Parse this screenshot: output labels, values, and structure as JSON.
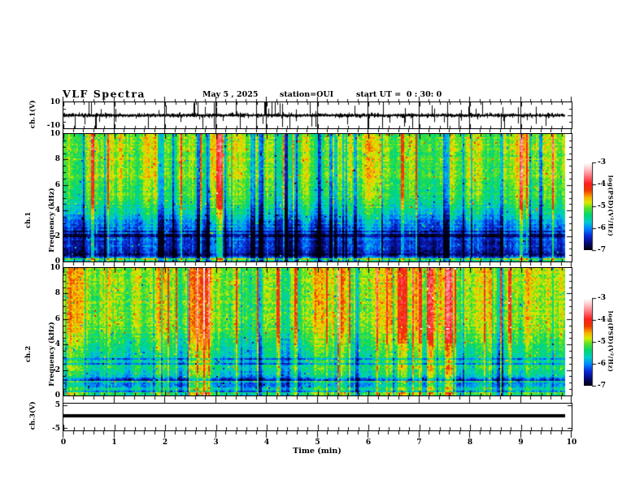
{
  "header": {
    "title": "VLF Spectra",
    "date": "May 5 , 2025",
    "station": "station=OUI",
    "start_ut": "start UT =  0 : 30: 0"
  },
  "x_axis": {
    "label": "Time (min)",
    "tick_labels": [
      "0",
      "1",
      "2",
      "3",
      "4",
      "5",
      "6",
      "7",
      "8",
      "9",
      "10"
    ],
    "range": [
      0,
      10
    ],
    "minor_ticks_per_major": 5
  },
  "panels": {
    "ch1_wave": {
      "y_label": "ch.1(V)",
      "tick_labels": [
        "10",
        "-10"
      ],
      "y_range": [
        -10,
        10
      ]
    },
    "ch1_spec": {
      "y_label_lines": [
        "ch.1",
        "Frequency (kHz)"
      ],
      "tick_labels": [
        "10",
        "8",
        "6",
        "4",
        "2",
        "0"
      ],
      "y_range": [
        0,
        10
      ]
    },
    "ch2_spec": {
      "y_label_lines": [
        "ch.2",
        "Frequency (kHz)"
      ],
      "tick_labels": [
        "10",
        "8",
        "6",
        "4",
        "2",
        "0"
      ],
      "y_range": [
        0,
        10
      ]
    },
    "ch3_wave": {
      "y_label": "ch.3(V)",
      "tick_labels": [
        "5",
        "-5"
      ],
      "y_range": [
        -5,
        5
      ]
    }
  },
  "colorbar": {
    "label": "log(PSD)(V²/Hz)",
    "tick_labels": [
      "-3",
      "-4",
      "-5",
      "-6",
      "-7"
    ],
    "range": [
      -7,
      -3
    ],
    "count": 2
  },
  "chart_data": [
    {
      "panel": "ch.1(V)",
      "type": "line",
      "xlabel": "Time (min)",
      "x_range": [
        0,
        10
      ],
      "y_range": [
        -10,
        10
      ],
      "y_ticks": [
        10,
        -10
      ],
      "description": "Broadband noise waveform centred on 0 V with many impulsive spikes reaching the ±10 V limits; vertical gridlines at every minute."
    },
    {
      "panel": "ch.1 spectrogram",
      "type": "heatmap",
      "xlabel": "Time (min)",
      "ylabel": "Frequency (kHz)",
      "x_range": [
        0,
        10
      ],
      "y_range": [
        0,
        10
      ],
      "z_label": "log(PSD)(V²/Hz)",
      "z_range": [
        -7,
        -3
      ],
      "background_levels": [
        {
          "freq_khz": [
            5,
            10
          ],
          "log_psd": -4.8
        },
        {
          "freq_khz": [
            3,
            5
          ],
          "log_psd": -5.5
        },
        {
          "freq_khz": [
            0.5,
            3
          ],
          "log_psd": -6.4
        },
        {
          "freq_khz": [
            0,
            0.3
          ],
          "log_psd": -4.9
        }
      ],
      "features": [
        "vertical red/orange impulse streaks above ~4 kHz",
        "dense dark-blue region with horizontal banding below ~3 kHz",
        "narrow green band along the bottom edge",
        "blue vertical dropout lines across all frequencies"
      ]
    },
    {
      "panel": "ch.2 spectrogram",
      "type": "heatmap",
      "xlabel": "Time (min)",
      "ylabel": "Frequency (kHz)",
      "x_range": [
        0,
        10
      ],
      "y_range": [
        0,
        10
      ],
      "z_label": "log(PSD)(V²/Hz)",
      "z_range": [
        -7,
        -3
      ],
      "background_levels": [
        {
          "freq_khz": [
            4,
            10
          ],
          "log_psd": -4.6
        },
        {
          "freq_khz": [
            2,
            4
          ],
          "log_psd": -5.3
        },
        {
          "freq_khz": [
            0,
            2
          ],
          "log_psd": -5.9
        }
      ],
      "features": [
        "stronger and denser red impulse streaks than ch.1",
        "bright cyan horizontal band near 2 kHz",
        "blue speckled horizontal bands below 2 kHz"
      ]
    },
    {
      "panel": "ch.3(V)",
      "type": "line",
      "xlabel": "Time (min)",
      "x_range": [
        0,
        10
      ],
      "y_range": [
        -5,
        5
      ],
      "y_ticks": [
        5,
        -5
      ],
      "description": "Flat thick black trace at 0 V for the whole 10 minutes."
    }
  ],
  "render": {
    "seeds": {
      "spec1": 12345,
      "spec2": 77777,
      "wave1": 424242
    },
    "colormap_stops": [
      [
        0.0,
        [
          255,
          255,
          255
        ]
      ],
      [
        0.07,
        [
          255,
          200,
          205
        ]
      ],
      [
        0.15,
        [
          255,
          120,
          130
        ]
      ],
      [
        0.24,
        [
          250,
          30,
          30
        ]
      ],
      [
        0.32,
        [
          235,
          60,
          0
        ]
      ],
      [
        0.4,
        [
          250,
          180,
          0
        ]
      ],
      [
        0.46,
        [
          215,
          235,
          0
        ]
      ],
      [
        0.52,
        [
          90,
          225,
          40
        ]
      ],
      [
        0.6,
        [
          0,
          215,
          110
        ]
      ],
      [
        0.68,
        [
          0,
          205,
          205
        ]
      ],
      [
        0.76,
        [
          0,
          130,
          255
        ]
      ],
      [
        0.84,
        [
          10,
          40,
          215
        ]
      ],
      [
        0.92,
        [
          5,
          10,
          120
        ]
      ],
      [
        1.0,
        [
          0,
          0,
          15
        ]
      ]
    ],
    "spec1": {
      "profile": [
        [
          0,
          0.49
        ],
        [
          0.3,
          0.5
        ],
        [
          0.5,
          0.56
        ],
        [
          0.62,
          0.64
        ],
        [
          0.72,
          0.76
        ],
        [
          0.82,
          0.82
        ],
        [
          0.94,
          0.85
        ],
        [
          0.972,
          0.87
        ],
        [
          0.982,
          0.5
        ],
        [
          1,
          0.55
        ]
      ],
      "red_prob": 0.055,
      "red_amt": 0.26,
      "blue_prob": 0.1,
      "blue_amt": 0.2,
      "noise": 0.1,
      "band_start": 0.66,
      "dark_row_prob": 0.22,
      "dark_row_amt": 0.1,
      "bright_row_prob": 0.07,
      "bright_row_amt": -0.13
    },
    "spec2": {
      "profile": [
        [
          0,
          0.47
        ],
        [
          0.45,
          0.49
        ],
        [
          0.6,
          0.58
        ],
        [
          0.72,
          0.64
        ],
        [
          0.8,
          0.58
        ],
        [
          0.86,
          0.7
        ],
        [
          0.93,
          0.72
        ],
        [
          0.955,
          0.62
        ],
        [
          0.975,
          0.74
        ],
        [
          0.985,
          0.55
        ],
        [
          1,
          0.6
        ]
      ],
      "red_prob": 0.085,
      "red_amt": 0.24,
      "blue_prob": 0.07,
      "blue_amt": 0.14,
      "noise": 0.11,
      "band_start": 0.7,
      "dark_row_prob": 0.18,
      "dark_row_amt": 0.12,
      "bright_row_prob": 0.08,
      "bright_row_amt": -0.1
    },
    "wave1": {
      "spike_count": 70,
      "full_spikes": 8
    }
  }
}
